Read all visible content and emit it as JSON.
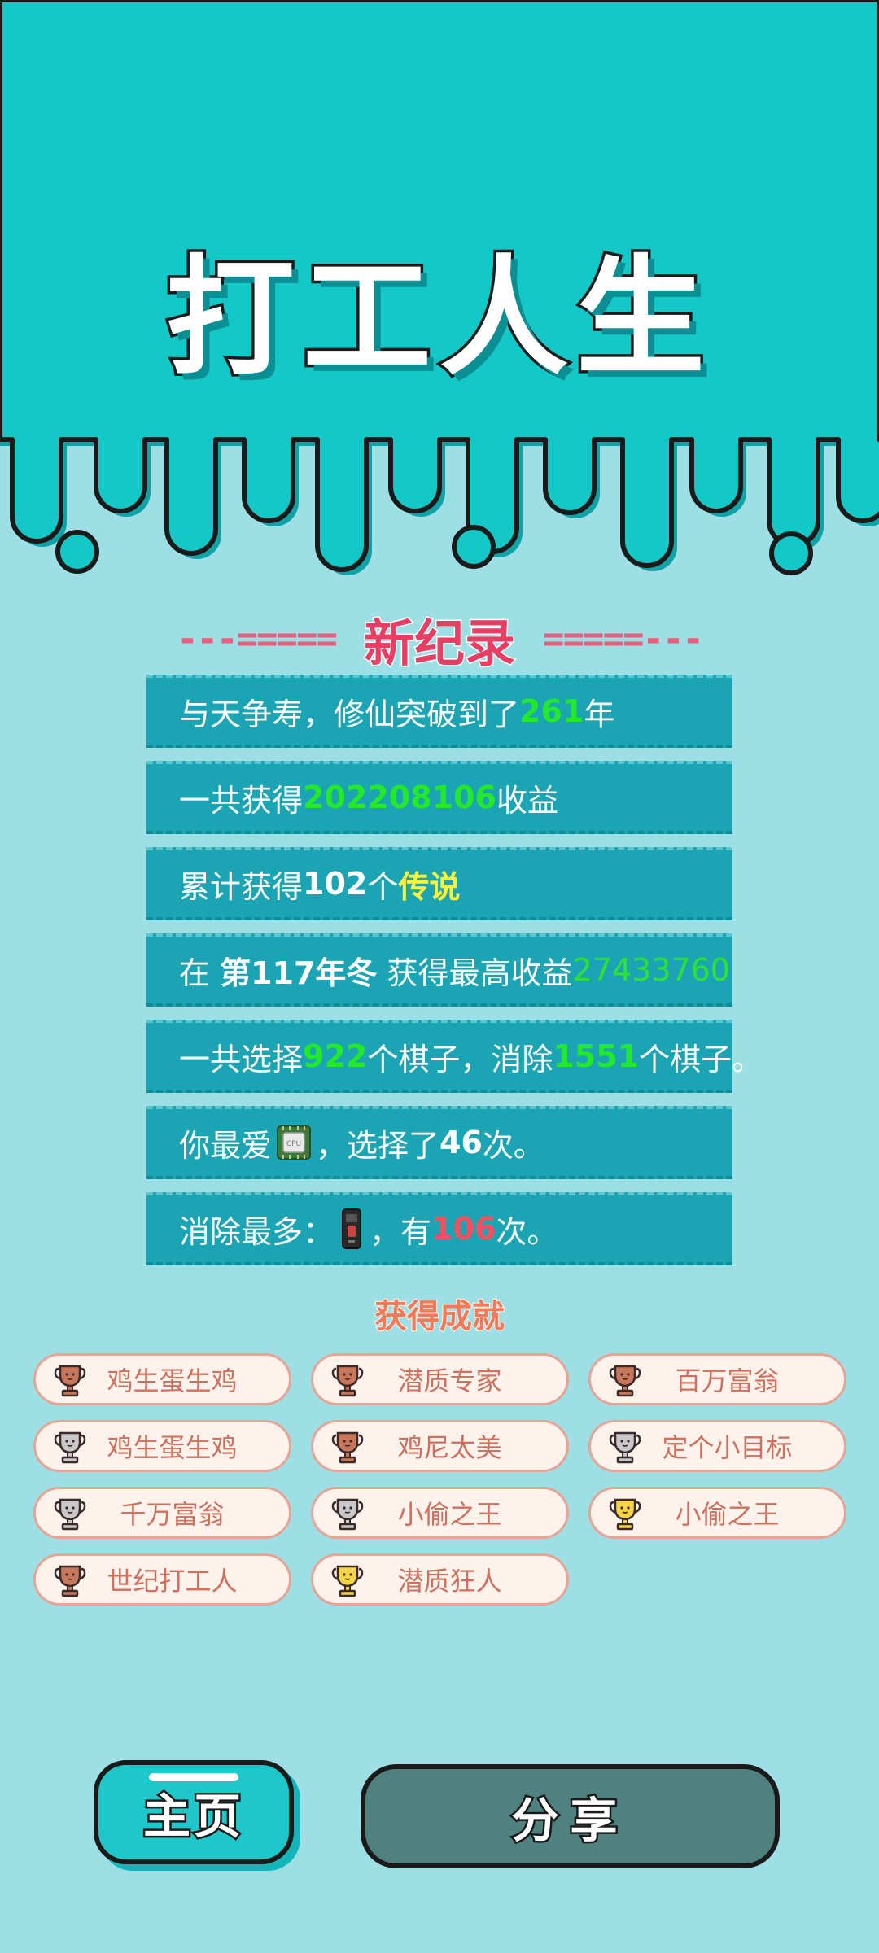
{
  "app_title": "打工人生",
  "record": {
    "left_deco": "---=====",
    "title": "新纪录",
    "right_deco": "=====---"
  },
  "stats": [
    {
      "pre": "与天争寿，修仙突破到了",
      "value": "261",
      "post": "年"
    },
    {
      "pre": "一共获得",
      "value": "202208106",
      "post": "收益"
    },
    {
      "pre": "累计获得",
      "value": "102",
      "mid": "个",
      "highlight": "传说"
    },
    {
      "pre": "在 ",
      "season": "第117年冬",
      "mid": " 获得最高收益",
      "value": "27433760"
    },
    {
      "pre": "一共选择",
      "value1": "922",
      "mid": "个棋子，消除",
      "value2": "1551",
      "post": "个棋子。"
    },
    {
      "pre": "你最爱",
      "icon": "cpu-chip-icon",
      "icon_text": "CPU",
      "mid": "，选择了",
      "value": "46",
      "post": "次。"
    },
    {
      "pre": "消除最多：",
      "icon": "smartphone-icon",
      "mid": "，有",
      "value": "106",
      "post": "次。"
    }
  ],
  "achievements_title": "获得成就",
  "achievements": [
    {
      "label": "鸡生蛋生鸡",
      "tier": "bronze"
    },
    {
      "label": "潜质专家",
      "tier": "bronze"
    },
    {
      "label": "百万富翁",
      "tier": "bronze"
    },
    {
      "label": "鸡生蛋生鸡",
      "tier": "silver"
    },
    {
      "label": "鸡尼太美",
      "tier": "bronze"
    },
    {
      "label": "定个小目标",
      "tier": "silver"
    },
    {
      "label": "千万富翁",
      "tier": "silver"
    },
    {
      "label": "小偷之王",
      "tier": "silver"
    },
    {
      "label": "小偷之王",
      "tier": "gold"
    },
    {
      "label": "世纪打工人",
      "tier": "bronze"
    },
    {
      "label": "潜质狂人",
      "tier": "gold"
    }
  ],
  "tier_colors": {
    "bronze": "#c9775a",
    "silver": "#c8c8c8",
    "gold": "#f5d547"
  },
  "buttons": {
    "home": "主页",
    "share": "分享"
  },
  "colors": {
    "top_bg": "#14c8c8",
    "page_bg": "#9edfe6",
    "stat_bg": "#1ba5b4",
    "accent_green": "#22ea28",
    "accent_red": "#ff4d5c",
    "accent_yellow": "#fff23a"
  }
}
